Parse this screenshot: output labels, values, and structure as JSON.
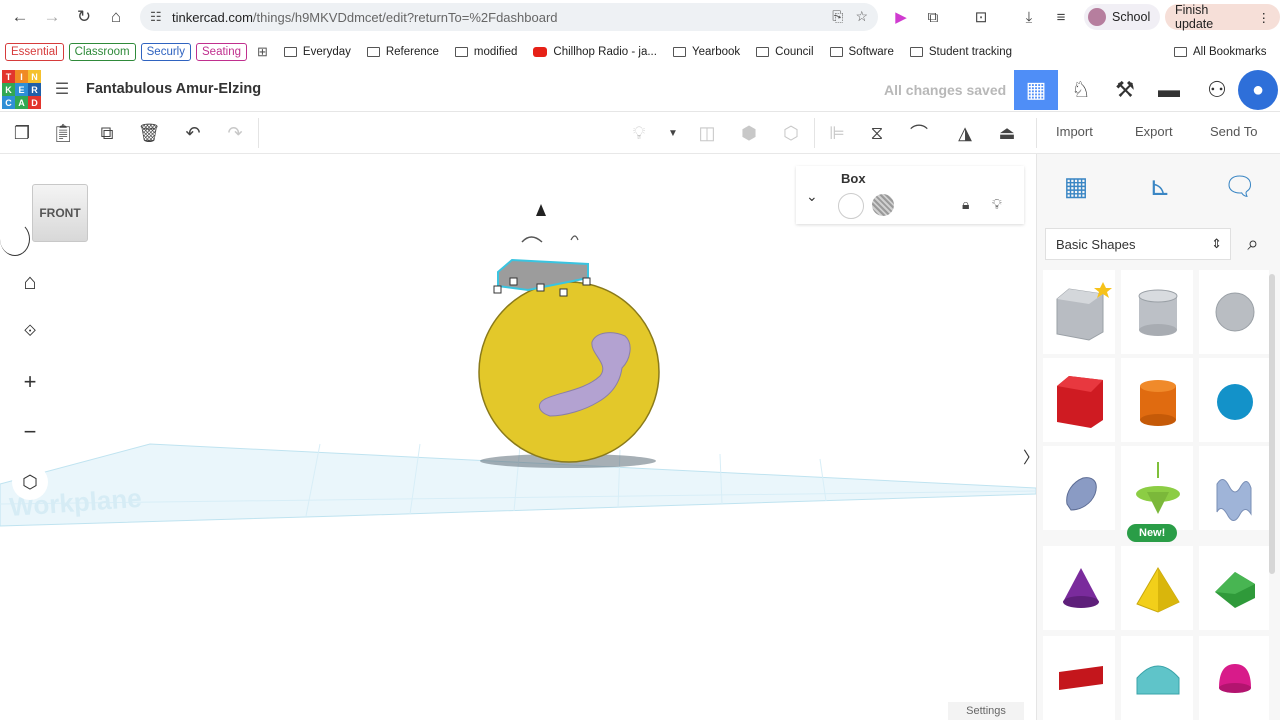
{
  "browser": {
    "url_host": "tinkercad.com",
    "url_path": "/things/h9MKVDdmcet/edit?returnTo=%2Fdashboard",
    "profile_label": "School",
    "update_label": "Finish update"
  },
  "bookmarks": {
    "tags": [
      {
        "label": "Essential",
        "color": "#d63b3b"
      },
      {
        "label": "Classroom",
        "color": "#2f8a3a"
      },
      {
        "label": "Securly",
        "color": "#2f63c0"
      },
      {
        "label": "Seating",
        "color": "#c02f8e"
      }
    ],
    "items": [
      "Everyday",
      "Reference",
      "modified",
      "Chillhop Radio - ja...",
      "Yearbook",
      "Council",
      "Software",
      "Student tracking"
    ],
    "all_label": "All Bookmarks"
  },
  "app": {
    "logo_letters": [
      "T",
      "I",
      "N",
      "K",
      "E",
      "R",
      "C",
      "A",
      "D"
    ],
    "design_title": "Fantabulous Amur-Elzing",
    "save_status": "All changes saved"
  },
  "toolbar": {
    "import_label": "Import",
    "export_label": "Export",
    "sendto_label": "Send To"
  },
  "viewport": {
    "view_cube_label": "FRONT",
    "workplane_label": "Workplane",
    "settings_label": "Settings"
  },
  "shape_props": {
    "name": "Box"
  },
  "shapes_panel": {
    "library_selected": "Basic Shapes",
    "new_badge": "New!",
    "shapes": [
      "box-shape",
      "cylinder-shape",
      "sphere-shape",
      "red-box-shape",
      "orange-cylinder-shape",
      "blue-sphere-shape",
      "scribble-shape",
      "spinning-top-shape",
      "wavy-shape",
      "cone-shape",
      "pyramid-shape",
      "roof-shape",
      "text-shape",
      "half-cylinder-shape",
      "paraboloid-shape"
    ]
  },
  "colors": {
    "accent_blue": "#4f8ef7",
    "sphere_yellow": "#e3c82a",
    "selection_cyan": "#3ac4e0"
  }
}
